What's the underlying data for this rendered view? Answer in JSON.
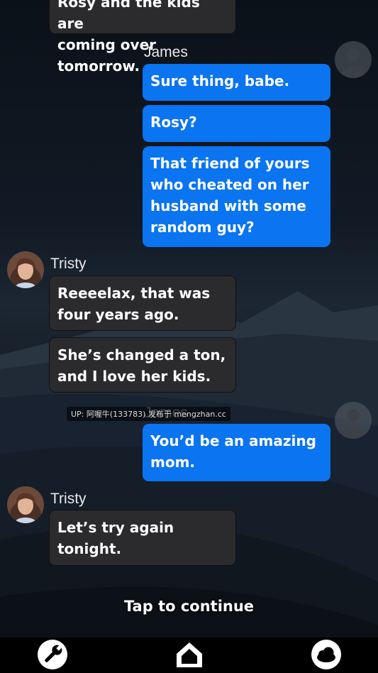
{
  "messages": [
    {
      "text": "Rosy and the kids are\ncoming over tomorrow."
    },
    {
      "text": "Sure thing, babe."
    },
    {
      "text": "Rosy?"
    },
    {
      "text": "That friend of yours\nwho cheated on her\nhusband with some\nrandom guy?"
    },
    {
      "text": "Reeeelax, that was\nfour years ago."
    },
    {
      "text": "She’s changed a ton,\nand I love her kids."
    },
    {
      "text": "You’d be an amazing\nmom."
    },
    {
      "text": "Let’s try again\ntonight."
    }
  ],
  "names": {
    "james": "James",
    "tristy": "Tristy"
  },
  "overlay": {
    "watermark": "UP: 阿喔牛(133783) 发布于 mengzhan.cc"
  },
  "tap_to_continue": "Tap to continue",
  "toolbar": {
    "settings_icon": "wrench-icon",
    "home_icon": "home-icon",
    "cloud_icon": "cloud-icon"
  },
  "colors": {
    "my_bubble": "#0b74f0",
    "their_bubble": "#2b2b2d",
    "accent_bar": "#000000"
  }
}
